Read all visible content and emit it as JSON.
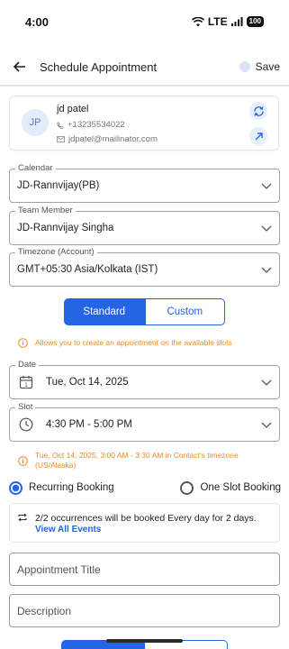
{
  "status_bar": {
    "time": "4:00",
    "network": "LTE",
    "battery": "100"
  },
  "header": {
    "title": "Schedule Appointment",
    "save_label": "Save"
  },
  "contact": {
    "initials": "JP",
    "name": "jd patel",
    "phone": "+13235534022",
    "email": "jdpatel@mailinator.com"
  },
  "fields": {
    "calendar": {
      "label": "Calendar",
      "value": "JD-Rannvijay(PB)"
    },
    "team_member": {
      "label": "Team Member",
      "value": "JD-Rannvijay Singha"
    },
    "timezone": {
      "label": "Timezone (Account)",
      "value": "GMT+05:30 Asia/Kolkata (IST)"
    },
    "date": {
      "label": "Date",
      "value": "Tue, Oct 14, 2025"
    },
    "slot": {
      "label": "Slot",
      "value": "4:30 PM - 5:00 PM"
    }
  },
  "mode_toggle": {
    "standard": "Standard",
    "custom": "Custom",
    "selected": "Standard"
  },
  "info": {
    "standard_hint": "Allows you to create an appointment on the available slots",
    "timezone_hint": "Tue, Oct 14, 2025, 3:00 AM - 3:30 AM in Contact's timezone (US/Alaska)"
  },
  "booking_type": {
    "recurring": "Recurring Booking",
    "one_slot": "One Slot Booking",
    "selected": "recurring"
  },
  "occurrences": {
    "text": "2/2 occurrences will be booked Every day for 2 days.",
    "link": "View All Events"
  },
  "inputs": {
    "title_placeholder": "Appointment Title",
    "description_placeholder": "Description"
  },
  "colors": {
    "accent": "#2564e3",
    "warning": "#ee8a23",
    "avatar_bg": "#e4ebfa"
  }
}
